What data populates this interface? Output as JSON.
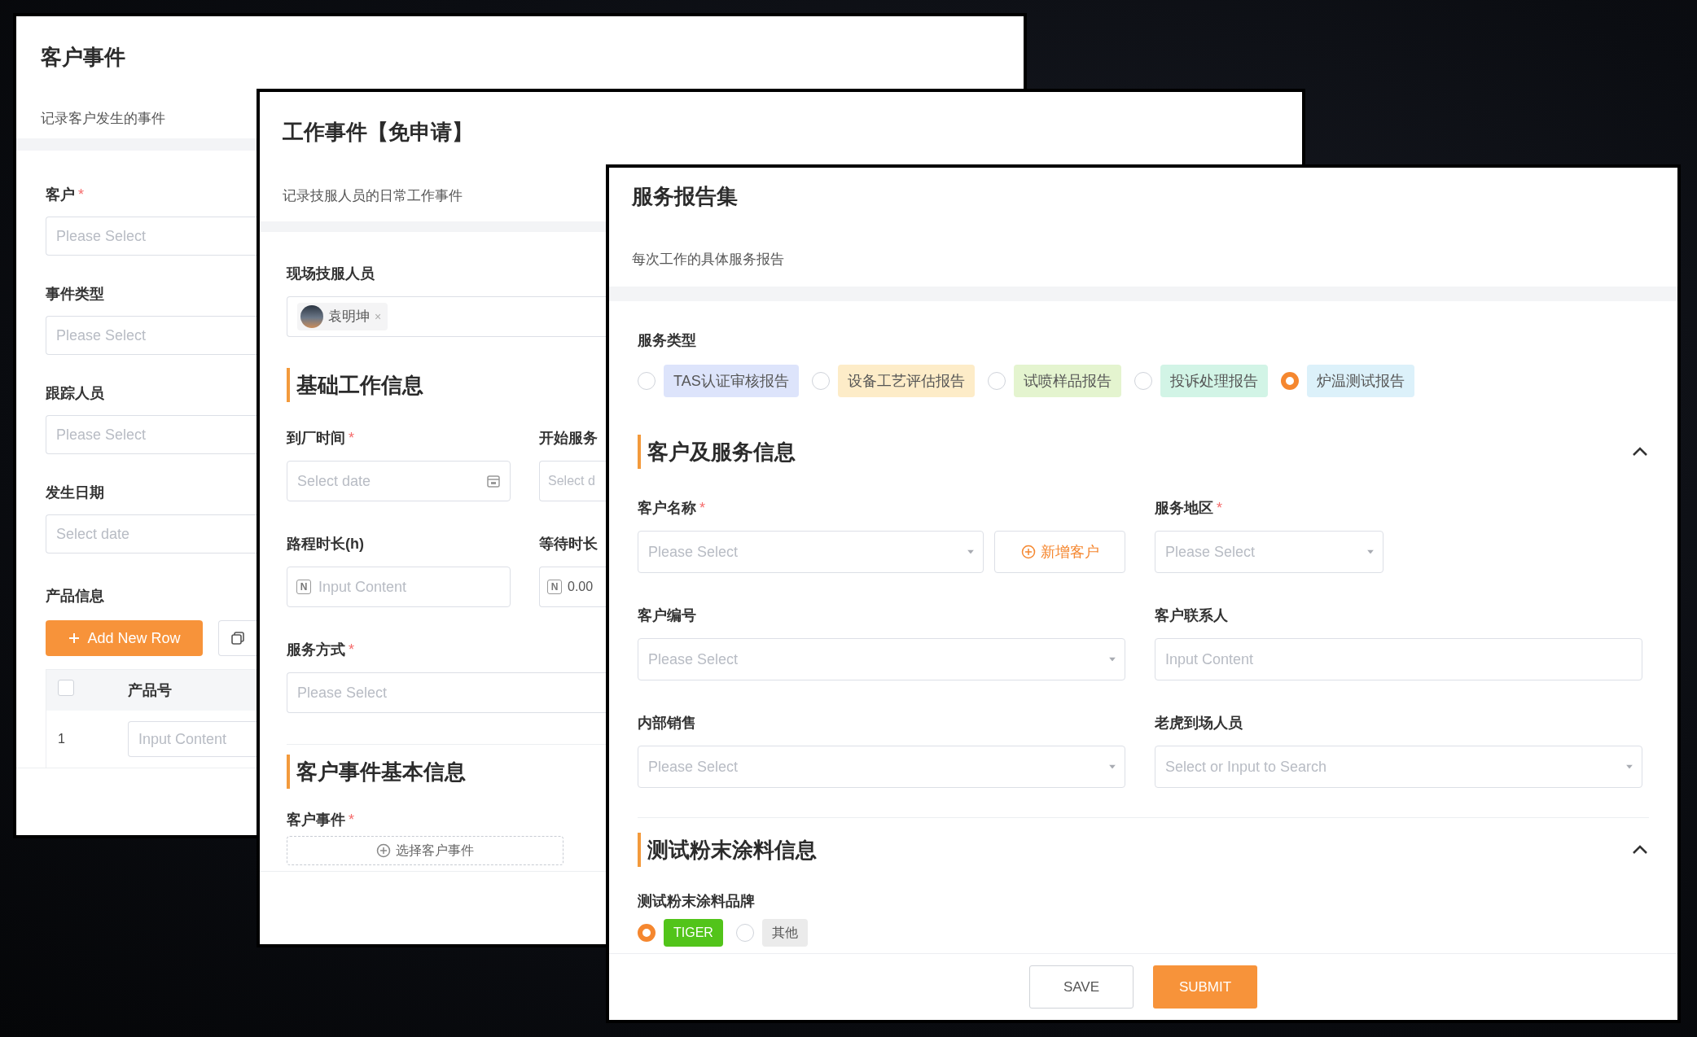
{
  "windows": [
    {
      "kind": "customer_event",
      "title": "客户事件",
      "subtitle": "记录客户发生的事件",
      "fields": [
        {
          "label": "客户",
          "required_mark": "*",
          "kind": "text",
          "placeholder": "Please Select"
        },
        {
          "label": "事件类型",
          "kind": "text",
          "placeholder": "Please Select"
        },
        {
          "label": "跟踪人员",
          "kind": "text",
          "placeholder": "Please Select"
        },
        {
          "label": "发生日期",
          "kind": "text",
          "placeholder": "Select date"
        }
      ],
      "product_info": {
        "label": "产品信息",
        "add_button": "Add New Row",
        "columns": [
          "产品号"
        ],
        "select_all_checked": false,
        "rows": [
          {
            "index": "1",
            "placeholder": "Input Content"
          }
        ]
      }
    },
    {
      "kind": "work_event",
      "title": "工作事件【免申请】",
      "subtitle": "记录技服人员的日常工作事件",
      "staff": {
        "label": "现场技服人员",
        "tags": [
          {
            "name": "袁明坤",
            "remove": "×"
          }
        ]
      },
      "sections": [
        {
          "title": "基础工作信息",
          "rows": [
            [
              {
                "label": "到厂时间",
                "required_mark": "*",
                "kind": "date",
                "placeholder": "Select date"
              },
              {
                "label": "开始服务",
                "kind": "text",
                "placeholder": "Select d"
              }
            ],
            [
              {
                "label": "路程时长(h)",
                "kind": "number",
                "prefix": "N",
                "placeholder": "Input Content"
              },
              {
                "label": "等待时长",
                "kind": "number",
                "prefix": "N",
                "value": "0.00"
              }
            ],
            [
              {
                "label": "服务方式",
                "required_mark": "*",
                "kind": "text",
                "placeholder": "Please Select"
              }
            ]
          ]
        },
        {
          "title": "客户事件基本信息",
          "rows": [
            [
              {
                "label": "客户事件",
                "required_mark": "*",
                "kind": "picker",
                "button": "选择客户事件"
              }
            ]
          ]
        }
      ]
    },
    {
      "kind": "service_report",
      "title": "服务报告集",
      "subtitle": "每次工作的具体服务报告",
      "service_types": {
        "label": "服务类型",
        "options": [
          {
            "label": "TAS认证审核报告",
            "color": "#dde4fb",
            "selected": false
          },
          {
            "label": "设备工艺评估报告",
            "color": "#fdecc8",
            "selected": false
          },
          {
            "label": "试喷样品报告",
            "color": "#e4f4cf",
            "selected": false
          },
          {
            "label": "投诉处理报告",
            "color": "#d2f4e6",
            "selected": false
          },
          {
            "label": "炉温测试报告",
            "color": "#dcf1fa",
            "selected": true
          }
        ]
      },
      "sections": [
        {
          "title": "客户及服务信息",
          "expanded": true,
          "rows": [
            [
              {
                "label": "客户名称",
                "required_mark": "*",
                "kind": "select",
                "placeholder": "Please Select",
                "button": "新增客户"
              },
              {
                "label": "服务地区",
                "required_mark": "*",
                "kind": "select",
                "placeholder": "Please Select"
              }
            ],
            [
              {
                "label": "客户编号",
                "kind": "select",
                "placeholder": "Please Select"
              },
              {
                "label": "客户联系人",
                "kind": "text",
                "placeholder": "Input Content"
              }
            ],
            [
              {
                "label": "内部销售",
                "kind": "select",
                "placeholder": "Please Select"
              },
              {
                "label": "老虎到场人员",
                "kind": "select",
                "placeholder": "Select or Input to Search"
              }
            ]
          ]
        },
        {
          "title": "测试粉末涂料信息",
          "expanded": true,
          "choices": {
            "label": "测试粉末涂料品牌",
            "options": [
              {
                "label": "TIGER",
                "color": "#52c41a",
                "selected": true
              },
              {
                "label": "其他",
                "color": "#ebebeb",
                "selected": false
              }
            ]
          }
        }
      ],
      "buttons": [
        {
          "label": "SAVE",
          "kind": "secondary"
        },
        {
          "label": "SUBMIT",
          "kind": "primary"
        }
      ]
    }
  ]
}
